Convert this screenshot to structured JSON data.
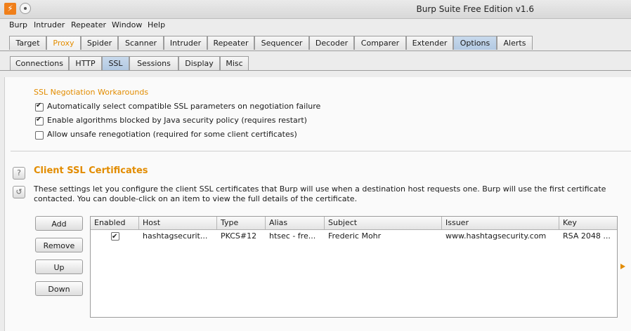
{
  "window": {
    "title": "Burp Suite Free Edition v1.6",
    "logo_glyph": "⚡"
  },
  "menubar": [
    "Burp",
    "Intruder",
    "Repeater",
    "Window",
    "Help"
  ],
  "top_tabs": [
    "Target",
    "Proxy",
    "Spider",
    "Scanner",
    "Intruder",
    "Repeater",
    "Sequencer",
    "Decoder",
    "Comparer",
    "Extender",
    "Options",
    "Alerts"
  ],
  "top_tabs_selected": "Options",
  "sub_tabs": [
    "Connections",
    "HTTP",
    "SSL",
    "Sessions",
    "Display",
    "Misc"
  ],
  "sub_tabs_selected": "SSL",
  "ssl_workarounds": {
    "heading": "SSL Negotiation Workarounds",
    "options": [
      {
        "label": "Automatically select compatible SSL parameters on negotiation failure",
        "checked": true
      },
      {
        "label": "Enable algorithms blocked by Java security policy (requires restart)",
        "checked": true
      },
      {
        "label": "Allow unsafe renegotiation (required for some client certificates)",
        "checked": false
      }
    ]
  },
  "client_certs": {
    "heading": "Client SSL Certificates",
    "help_icon": "?",
    "refresh_icon": "↺",
    "description_line1": "These settings let you configure the client SSL certificates that Burp will use when a destination host requests one. Burp will use the first certificate",
    "description_line2": "contacted. You can double-click on an item to view the full details of the certificate.",
    "buttons": {
      "add": "Add",
      "remove": "Remove",
      "up": "Up",
      "down": "Down"
    },
    "columns": [
      "Enabled",
      "Host",
      "Type",
      "Alias",
      "Subject",
      "Issuer",
      "Key"
    ],
    "rows": [
      {
        "enabled": true,
        "host": "hashtagsecurit...",
        "type": "PKCS#12",
        "alias": "htsec - fre...",
        "subject": "Frederic Mohr",
        "issuer": "www.hashtagsecurity.com",
        "key": "RSA 2048 ..."
      }
    ]
  },
  "colors": {
    "accent": "#e28c00",
    "selected_tab": "#b9cde4",
    "logo": "#f07f1a"
  }
}
